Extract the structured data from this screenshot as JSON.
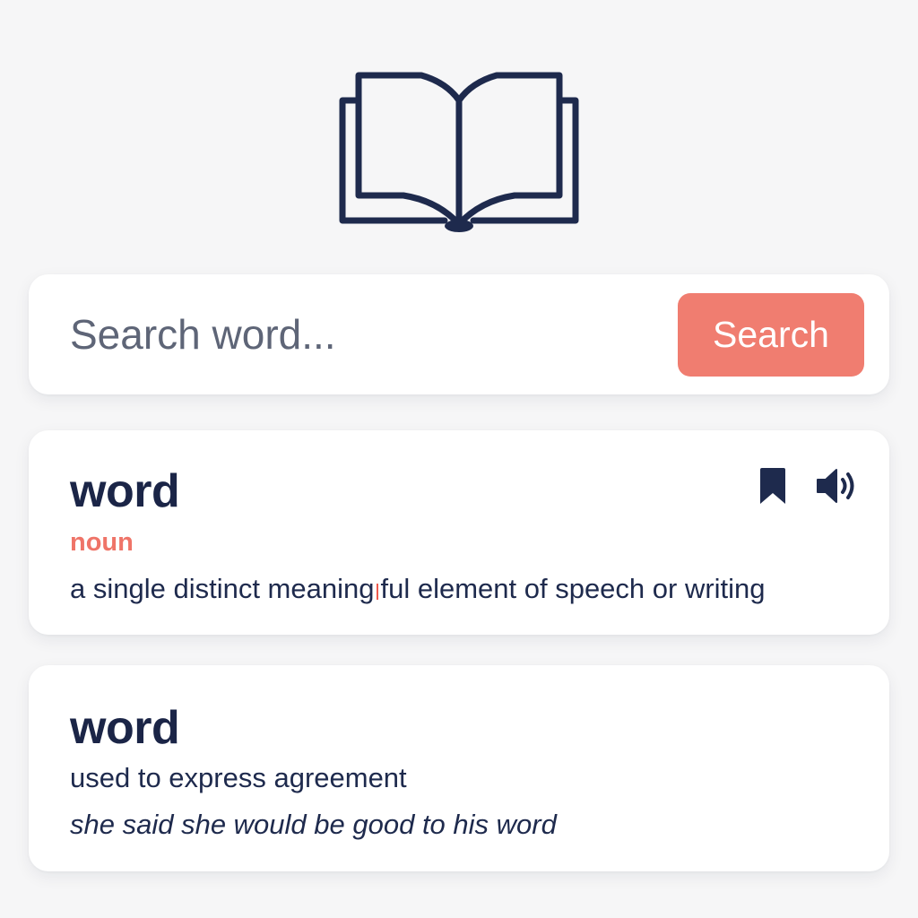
{
  "app": {
    "logo_icon": "open-book-icon",
    "colors": {
      "navy": "#1e2a4d",
      "accent": "#f07d70",
      "background": "#f6f6f7",
      "card": "#ffffff"
    }
  },
  "search": {
    "placeholder": "Search word...",
    "value": "",
    "button_label": "Search"
  },
  "entries": [
    {
      "word": "word",
      "part_of_speech": "noun",
      "definition_before_cursor": "a single distinct meaning",
      "definition_after_cursor": "ful element of speech or writing",
      "actions": {
        "bookmark_icon": "bookmark-icon",
        "audio_icon": "speaker-icon"
      }
    },
    {
      "word": "word",
      "definition": "used to express agreement",
      "example": "she said she would be good to his word"
    }
  ]
}
